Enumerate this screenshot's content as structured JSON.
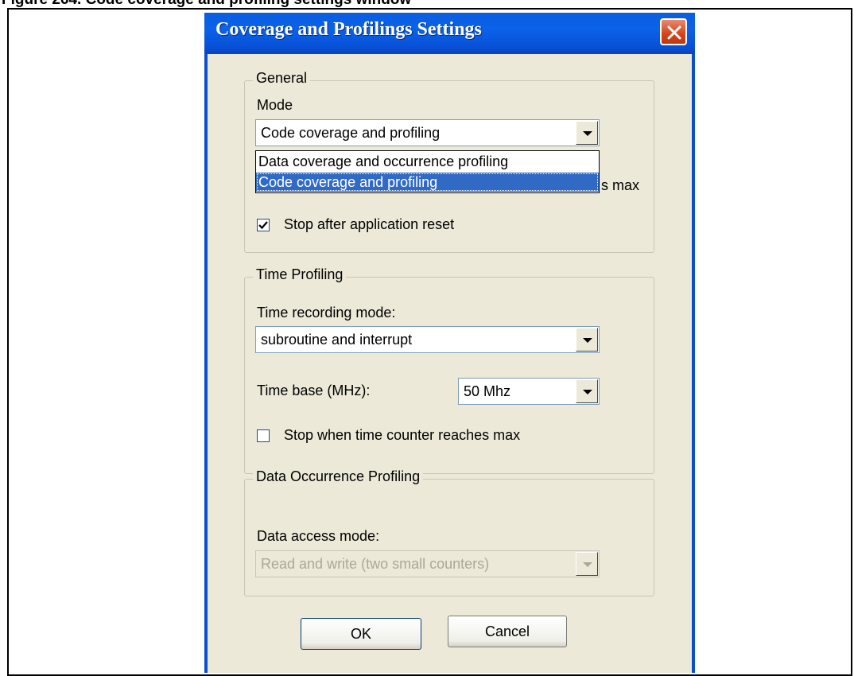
{
  "caption": "Figure 264. Code coverage and profiling settings window",
  "window": {
    "title": "Coverage and Profilings Settings",
    "close_icon": "close-icon"
  },
  "general": {
    "legend": "General",
    "mode_label": "Mode",
    "mode_value": "Code coverage and profiling",
    "mode_options": [
      "Data coverage and occurrence profiling",
      "Code coverage and profiling"
    ],
    "mode_selected_index": 1,
    "hidden_text_fragment": "s max",
    "stop_after_reset_label": "Stop after application reset",
    "stop_after_reset_checked": true
  },
  "time_profiling": {
    "legend": "Time Profiling",
    "recording_mode_label": "Time recording mode:",
    "recording_mode_value": "subroutine and interrupt",
    "time_base_label": "Time base (MHz):",
    "time_base_value": "50 Mhz",
    "stop_counter_label": "Stop when time counter reaches max",
    "stop_counter_checked": false
  },
  "data_occurrence": {
    "legend": "Data Occurrence Profiling",
    "access_mode_label": "Data access mode:",
    "access_mode_value": "Read and write (two small counters)",
    "access_mode_disabled": true
  },
  "buttons": {
    "ok": "OK",
    "cancel": "Cancel"
  },
  "colors": {
    "titlebar": "#0b62e8",
    "dialog_bg": "#ece9d8",
    "selection": "#316ac5",
    "close_button": "#d4431a"
  }
}
